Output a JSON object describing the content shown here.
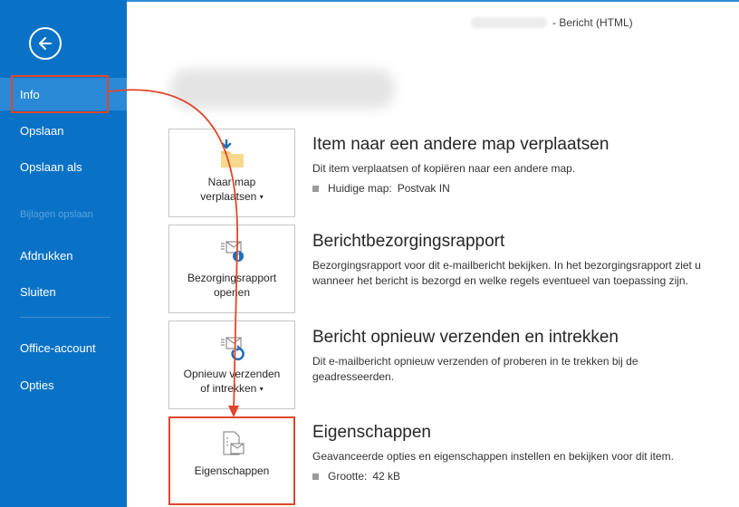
{
  "window": {
    "title_suffix": "- Bericht (HTML)"
  },
  "sidebar": {
    "items": [
      {
        "label": "Info"
      },
      {
        "label": "Opslaan"
      },
      {
        "label": "Opslaan als"
      },
      {
        "label": "Bijlagen opslaan"
      },
      {
        "label": "Afdrukken"
      },
      {
        "label": "Sluiten"
      },
      {
        "label": "Office-account"
      },
      {
        "label": "Opties"
      }
    ]
  },
  "sections": [
    {
      "tile_label_line1": "Naar map",
      "tile_label_line2": "verplaatsen",
      "title": "Item naar een andere map verplaatsen",
      "desc": "Dit item verplaatsen of kopiëren naar een andere map.",
      "meta_label": "Huidige map:",
      "meta_value": "Postvak IN"
    },
    {
      "tile_label_line1": "Bezorgingsrapport",
      "tile_label_line2": "openen",
      "title": "Berichtbezorgingsrapport",
      "desc": "Bezorgingsrapport voor dit e-mailbericht bekijken. In het bezorgingsrapport ziet u wanneer het bericht is bezorgd en welke regels eventueel van toepassing zijn."
    },
    {
      "tile_label_line1": "Opnieuw verzenden",
      "tile_label_line2": "of intrekken",
      "title": "Bericht opnieuw verzenden en intrekken",
      "desc": "Dit e-mailbericht opnieuw verzenden of proberen in te trekken bij de geadresseerden."
    },
    {
      "tile_label_line1": "Eigenschappen",
      "title": "Eigenschappen",
      "desc": "Geavanceerde opties en eigenschappen instellen en bekijken voor dit item.",
      "meta_label": "Grootte:",
      "meta_value": "42 kB"
    }
  ],
  "colors": {
    "sidebar": "#0a72c6",
    "sidebar_active": "#2a8ad8",
    "highlight": "#e0472b",
    "folder": "#f4c86a",
    "accent_blue": "#1f6fb8"
  }
}
